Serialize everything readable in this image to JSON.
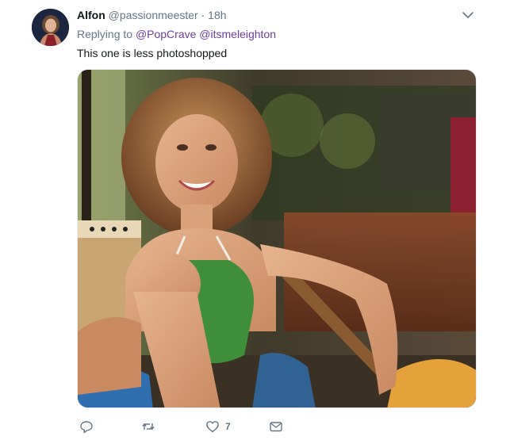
{
  "tweet": {
    "display_name": "Alfon",
    "handle": "@passionmeester",
    "separator": "·",
    "time": "18h",
    "replying_prefix": "Replying to",
    "mentions": [
      "@PopCrave",
      "@itsmeleighton"
    ],
    "text": "This one is less photoshopped"
  },
  "actions": {
    "reply_count": "",
    "retweet_count": "",
    "like_count": "7",
    "icons": [
      "reply-icon",
      "retweet-icon",
      "heart-icon",
      "envelope-icon"
    ]
  },
  "colors": {
    "text": "#14171a",
    "secondary": "#657786",
    "mention": "#6b3fa0",
    "border": "#e6ecf0"
  }
}
